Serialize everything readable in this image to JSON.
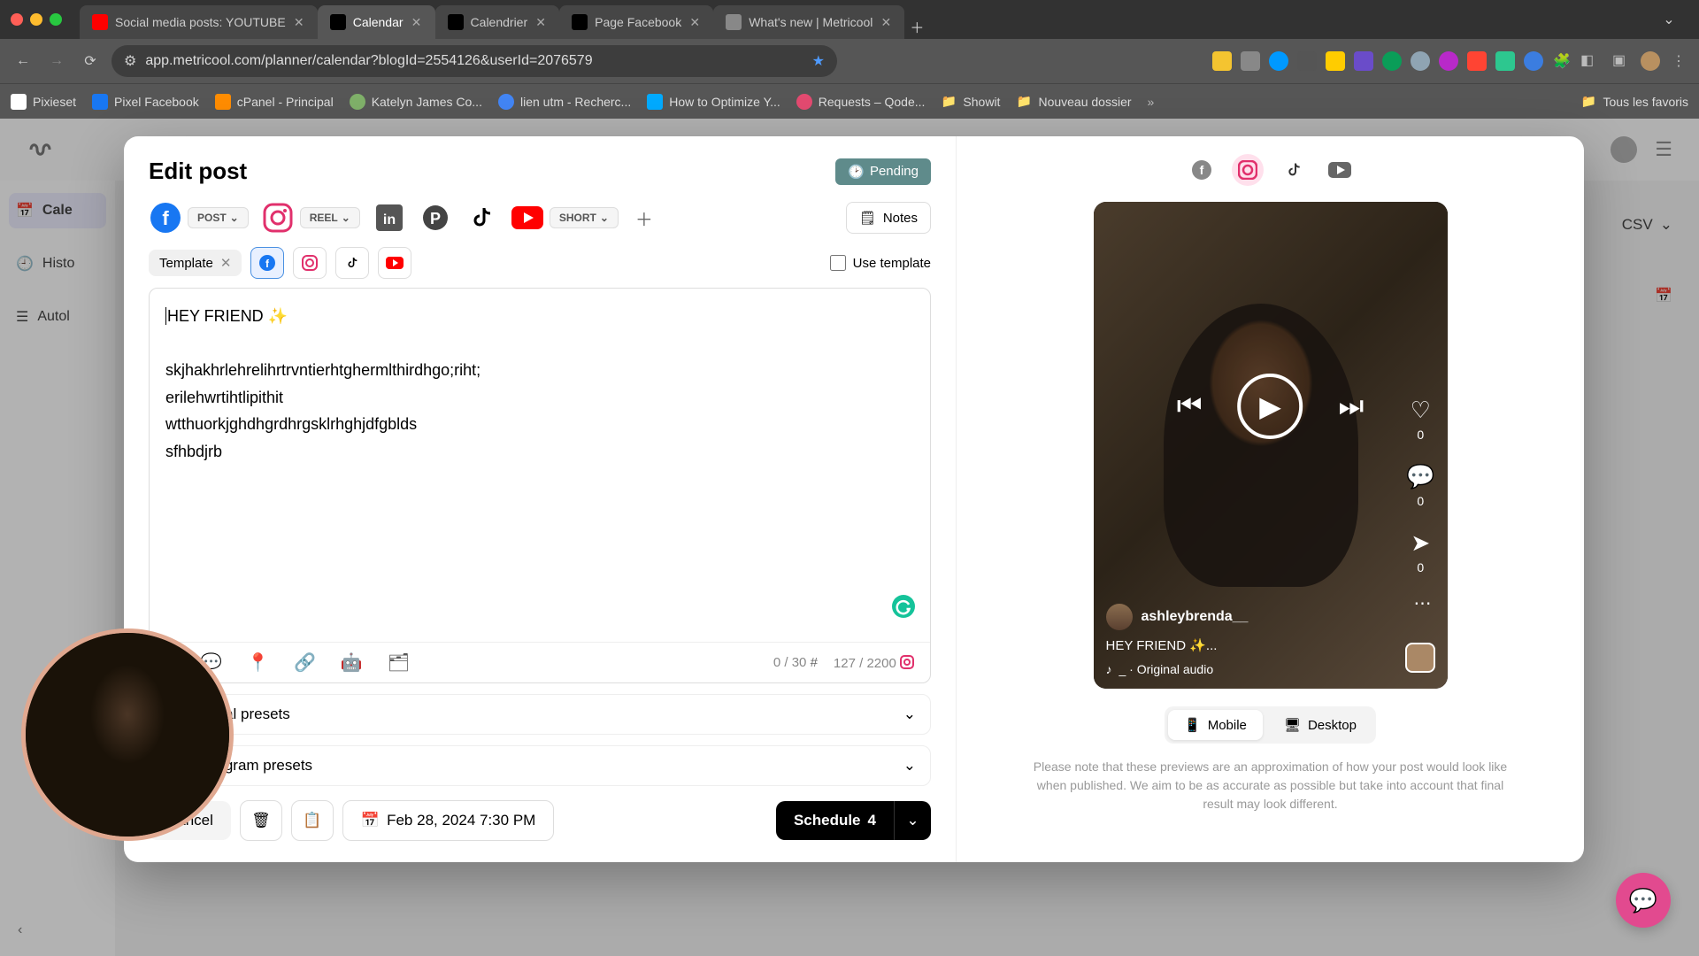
{
  "browser": {
    "tabs": [
      {
        "title": "Social media posts: YOUTUBE",
        "favicon": "#ff0000"
      },
      {
        "title": "Calendar",
        "favicon": "#000",
        "active": true
      },
      {
        "title": "Calendrier",
        "favicon": "#000"
      },
      {
        "title": "Page Facebook",
        "favicon": "#000"
      },
      {
        "title": "What's new | Metricool",
        "favicon": "#888"
      }
    ],
    "url": "app.metricool.com/planner/calendar?blogId=2554126&userId=2076579",
    "bookmarks": [
      {
        "label": "Pixieset",
        "color": "#fff"
      },
      {
        "label": "Pixel Facebook",
        "color": "#1877f2"
      },
      {
        "label": "cPanel - Principal",
        "color": "#ff8c00"
      },
      {
        "label": "Katelyn James Co...",
        "color": "#7fb069"
      },
      {
        "label": "lien utm - Recherc...",
        "color": "#4285f4"
      },
      {
        "label": "How to Optimize Y...",
        "color": "#00aaff"
      },
      {
        "label": "Requests – Qode...",
        "color": "#e34a70"
      },
      {
        "label": "Showit",
        "color": "#999"
      },
      {
        "label": "Nouveau dossier",
        "color": "#999"
      }
    ],
    "all_favorites": "Tous les favoris"
  },
  "sidebar": {
    "items": [
      {
        "label": "Cale",
        "icon": "calendar"
      },
      {
        "label": "Histo",
        "icon": "history"
      },
      {
        "label": "Autol",
        "icon": "list"
      }
    ]
  },
  "rightbar": {
    "csv": "CSV"
  },
  "modal": {
    "title": "Edit post",
    "status": "Pending",
    "platforms": {
      "facebook_type": "POST",
      "instagram_type": "REEL",
      "youtube_type": "SHORT"
    },
    "notes": "Notes",
    "template_chip": "Template",
    "use_template": "Use template",
    "editor": {
      "line1": "HEY FRIEND ✨",
      "line2": "skjhakhrlehrelihrtrvntierhtghermlthirdhgo;riht;",
      "line3": "erilehwrtihtlipithit",
      "line4": "wtthuorkjghdhgrdhrgsklrhghjdfgblds",
      "line5": "sfhbdjrb"
    },
    "counts": {
      "hashtags": "0 / 30",
      "chars": "127 / 2200"
    },
    "presets": {
      "global": "Global presets",
      "instagram": "Instagram presets"
    },
    "cancel": "Cancel",
    "datetime": "Feb 28, 2024 7:30 PM",
    "schedule_label": "Schedule",
    "schedule_count": "4"
  },
  "preview": {
    "username": "ashleybrenda__",
    "caption": "HEY FRIEND ✨...",
    "audio": "_ · Original audio",
    "like_count": "0",
    "comment_count": "0",
    "share_count": "0",
    "mobile": "Mobile",
    "desktop": "Desktop",
    "note": "Please note that these previews are an approximation of how your post would look like when published. We aim to be as accurate as possible but take into account that final result may look different."
  }
}
